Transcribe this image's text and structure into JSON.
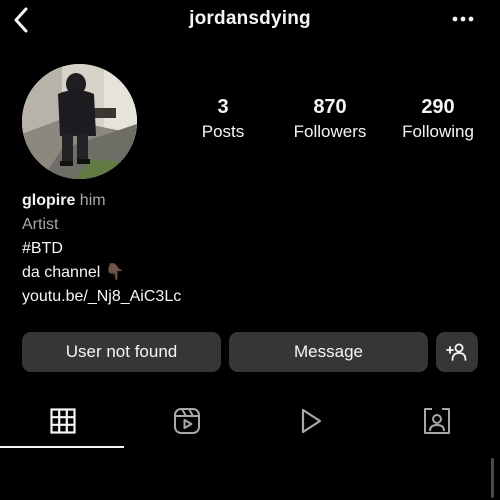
{
  "header": {
    "username": "jordansdying",
    "back_icon": "chevron-left-icon",
    "more_icon": "more-horizontal-icon"
  },
  "profile": {
    "avatar_icon": "profile-photo",
    "stats": [
      {
        "value": "3",
        "label": "Posts"
      },
      {
        "value": "870",
        "label": "Followers"
      },
      {
        "value": "290",
        "label": "Following"
      }
    ]
  },
  "bio": {
    "name": "glopire",
    "pronoun": "him",
    "category": "Artist",
    "line1": "#BTD",
    "line2": "da channel 👇🏿",
    "link": "youtu.be/_Nj8_AiC3Lc"
  },
  "actions": {
    "primary_label": "User not found",
    "message_label": "Message",
    "suggest_icon": "add-person-icon"
  },
  "tabs": [
    {
      "icon": "grid-icon",
      "active": true
    },
    {
      "icon": "reels-icon",
      "active": false
    },
    {
      "icon": "play-icon",
      "active": false
    },
    {
      "icon": "tagged-icon",
      "active": false
    }
  ],
  "colors": {
    "background": "#000000",
    "text": "#f5f5f5",
    "secondary_text": "#a8a8a8",
    "button": "#363636"
  }
}
